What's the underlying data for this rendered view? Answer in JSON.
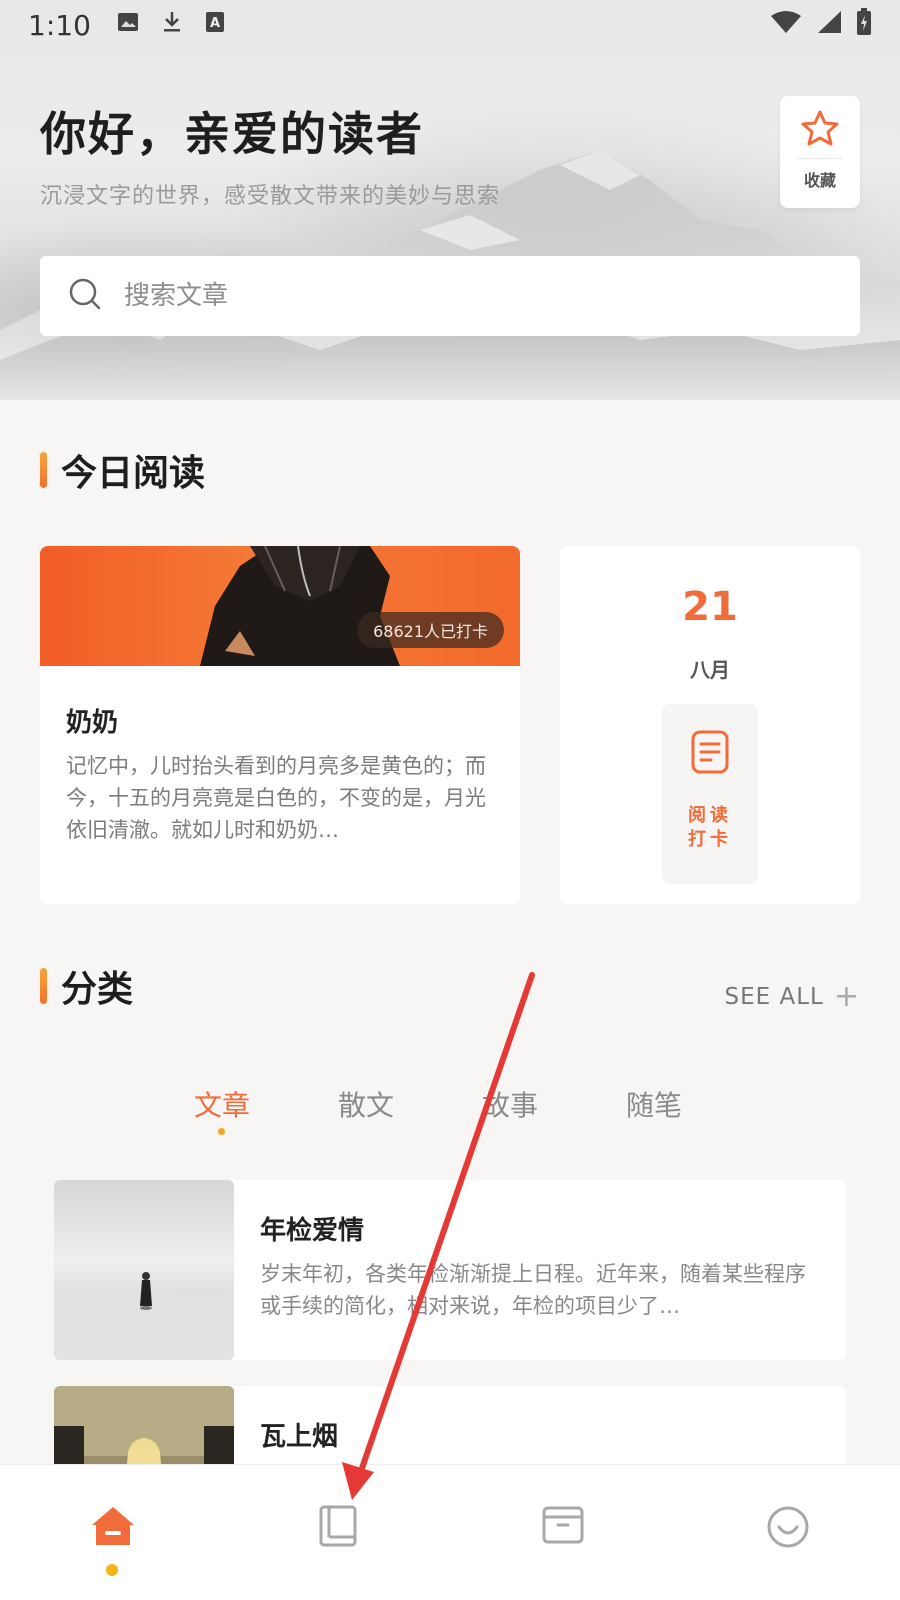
{
  "status_bar": {
    "time": "1:10",
    "left_icons": [
      "image-icon",
      "download-icon",
      "text-a-icon"
    ],
    "right_icons": [
      "wifi-icon",
      "signal-icon",
      "battery-icon"
    ]
  },
  "header": {
    "greeting": "你好，亲爱的读者",
    "subtitle": "沉浸文字的世界，感受散文带来的美妙与思索",
    "favorite_label": "收藏"
  },
  "search": {
    "placeholder": "搜索文章"
  },
  "today_section": {
    "title": "今日阅读",
    "featured": {
      "badge": "68621人已打卡",
      "title": "奶奶",
      "excerpt": "记忆中，儿时抬头看到的月亮多是黄色的；而今，十五的月亮竟是白色的，不变的是，月光依旧清澈。就如儿时和奶奶…"
    },
    "date": {
      "day": "21",
      "month": "八月",
      "checkin_label": "阅读打卡"
    }
  },
  "category_section": {
    "title": "分类",
    "see_all": "SEE ALL",
    "tabs": [
      "文章",
      "散文",
      "故事",
      "随笔"
    ],
    "active_tab": 0
  },
  "articles": [
    {
      "title": "年检爱情",
      "excerpt": "岁末年初，各类年检渐渐提上日程。近年来，随着某些程序或手续的简化，相对来说，年检的项目少了…"
    },
    {
      "title": "瓦上烟",
      "excerpt": ""
    }
  ],
  "bottom_nav": {
    "items": [
      "home-icon",
      "book-icon",
      "archive-icon",
      "smile-icon"
    ],
    "active": 0
  },
  "colors": {
    "accent": "#f26b3a",
    "accent_yellow": "#f5a623",
    "background": "#f8f6f4",
    "annotation_arrow": "#e53935"
  }
}
